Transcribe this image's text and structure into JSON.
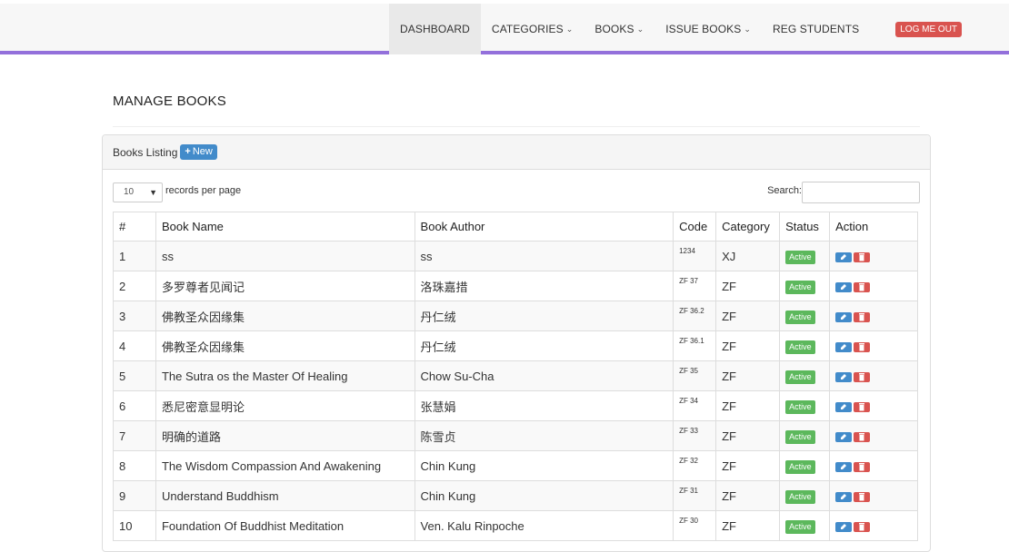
{
  "nav": {
    "items": [
      {
        "label": "DASHBOARD",
        "caret": false,
        "active": true
      },
      {
        "label": "CATEGORIES",
        "caret": true,
        "active": false
      },
      {
        "label": "BOOKS",
        "caret": true,
        "active": false
      },
      {
        "label": "ISSUE BOOKS",
        "caret": true,
        "active": false
      },
      {
        "label": "REG STUDENTS",
        "caret": false,
        "active": false
      }
    ],
    "logout_label": "LOG ME OUT",
    "accent_color": "#9370db"
  },
  "page": {
    "title": "MANAGE BOOKS"
  },
  "panel": {
    "heading": "Books Listing",
    "new_button": "New"
  },
  "controls": {
    "records_value": "10",
    "records_label": "records per page",
    "search_label": "Search:",
    "search_value": ""
  },
  "table": {
    "headers": [
      "#",
      "Book Name",
      "Book Author",
      "Code",
      "Category",
      "Status",
      "Action"
    ],
    "rows": [
      {
        "num": "1",
        "name": "ss",
        "author": "ss",
        "code": "1234",
        "category": "XJ",
        "status": "Active"
      },
      {
        "num": "2",
        "name": "多罗尊者见闻记",
        "author": "洛珠嘉措",
        "code": "ZF 37",
        "category": "ZF",
        "status": "Active"
      },
      {
        "num": "3",
        "name": "佛教圣众因缘集",
        "author": "丹仁绒",
        "code": "ZF 36.2",
        "category": "ZF",
        "status": "Active"
      },
      {
        "num": "4",
        "name": "佛教圣众因缘集",
        "author": "丹仁绒",
        "code": "ZF 36.1",
        "category": "ZF",
        "status": "Active"
      },
      {
        "num": "5",
        "name": "The Sutra os the Master Of Healing",
        "author": "Chow Su-Cha",
        "code": "ZF 35",
        "category": "ZF",
        "status": "Active"
      },
      {
        "num": "6",
        "name": "悉尼密意显明论",
        "author": "张慧娟",
        "code": "ZF 34",
        "category": "ZF",
        "status": "Active"
      },
      {
        "num": "7",
        "name": "明确的道路",
        "author": "陈雪贞",
        "code": "ZF 33",
        "category": "ZF",
        "status": "Active"
      },
      {
        "num": "8",
        "name": "The Wisdom Compassion And Awakening",
        "author": "Chin Kung",
        "code": "ZF 32",
        "category": "ZF",
        "status": "Active"
      },
      {
        "num": "9",
        "name": "Understand Buddhism",
        "author": "Chin Kung",
        "code": "ZF 31",
        "category": "ZF",
        "status": "Active"
      },
      {
        "num": "10",
        "name": "Foundation Of Buddhist Meditation",
        "author": "Ven. Kalu Rinpoche",
        "code": "ZF 30",
        "category": "ZF",
        "status": "Active"
      }
    ]
  }
}
